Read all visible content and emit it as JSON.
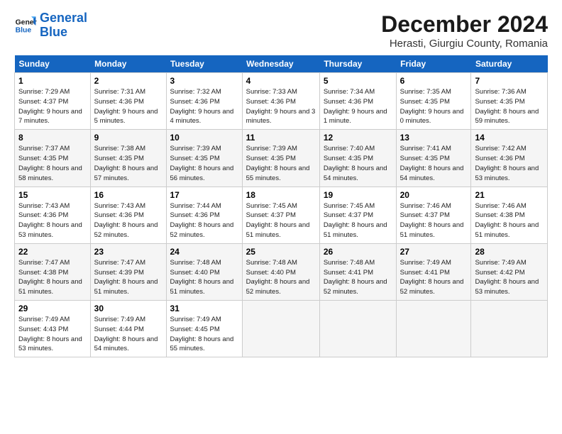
{
  "logo": {
    "line1": "General",
    "line2": "Blue"
  },
  "title": "December 2024",
  "subtitle": "Herasti, Giurgiu County, Romania",
  "days_of_week": [
    "Sunday",
    "Monday",
    "Tuesday",
    "Wednesday",
    "Thursday",
    "Friday",
    "Saturday"
  ],
  "weeks": [
    [
      {
        "num": "1",
        "sunrise": "Sunrise: 7:29 AM",
        "sunset": "Sunset: 4:37 PM",
        "daylight": "Daylight: 9 hours and 7 minutes."
      },
      {
        "num": "2",
        "sunrise": "Sunrise: 7:31 AM",
        "sunset": "Sunset: 4:36 PM",
        "daylight": "Daylight: 9 hours and 5 minutes."
      },
      {
        "num": "3",
        "sunrise": "Sunrise: 7:32 AM",
        "sunset": "Sunset: 4:36 PM",
        "daylight": "Daylight: 9 hours and 4 minutes."
      },
      {
        "num": "4",
        "sunrise": "Sunrise: 7:33 AM",
        "sunset": "Sunset: 4:36 PM",
        "daylight": "Daylight: 9 hours and 3 minutes."
      },
      {
        "num": "5",
        "sunrise": "Sunrise: 7:34 AM",
        "sunset": "Sunset: 4:36 PM",
        "daylight": "Daylight: 9 hours and 1 minute."
      },
      {
        "num": "6",
        "sunrise": "Sunrise: 7:35 AM",
        "sunset": "Sunset: 4:35 PM",
        "daylight": "Daylight: 9 hours and 0 minutes."
      },
      {
        "num": "7",
        "sunrise": "Sunrise: 7:36 AM",
        "sunset": "Sunset: 4:35 PM",
        "daylight": "Daylight: 8 hours and 59 minutes."
      }
    ],
    [
      {
        "num": "8",
        "sunrise": "Sunrise: 7:37 AM",
        "sunset": "Sunset: 4:35 PM",
        "daylight": "Daylight: 8 hours and 58 minutes."
      },
      {
        "num": "9",
        "sunrise": "Sunrise: 7:38 AM",
        "sunset": "Sunset: 4:35 PM",
        "daylight": "Daylight: 8 hours and 57 minutes."
      },
      {
        "num": "10",
        "sunrise": "Sunrise: 7:39 AM",
        "sunset": "Sunset: 4:35 PM",
        "daylight": "Daylight: 8 hours and 56 minutes."
      },
      {
        "num": "11",
        "sunrise": "Sunrise: 7:39 AM",
        "sunset": "Sunset: 4:35 PM",
        "daylight": "Daylight: 8 hours and 55 minutes."
      },
      {
        "num": "12",
        "sunrise": "Sunrise: 7:40 AM",
        "sunset": "Sunset: 4:35 PM",
        "daylight": "Daylight: 8 hours and 54 minutes."
      },
      {
        "num": "13",
        "sunrise": "Sunrise: 7:41 AM",
        "sunset": "Sunset: 4:35 PM",
        "daylight": "Daylight: 8 hours and 54 minutes."
      },
      {
        "num": "14",
        "sunrise": "Sunrise: 7:42 AM",
        "sunset": "Sunset: 4:36 PM",
        "daylight": "Daylight: 8 hours and 53 minutes."
      }
    ],
    [
      {
        "num": "15",
        "sunrise": "Sunrise: 7:43 AM",
        "sunset": "Sunset: 4:36 PM",
        "daylight": "Daylight: 8 hours and 53 minutes."
      },
      {
        "num": "16",
        "sunrise": "Sunrise: 7:43 AM",
        "sunset": "Sunset: 4:36 PM",
        "daylight": "Daylight: 8 hours and 52 minutes."
      },
      {
        "num": "17",
        "sunrise": "Sunrise: 7:44 AM",
        "sunset": "Sunset: 4:36 PM",
        "daylight": "Daylight: 8 hours and 52 minutes."
      },
      {
        "num": "18",
        "sunrise": "Sunrise: 7:45 AM",
        "sunset": "Sunset: 4:37 PM",
        "daylight": "Daylight: 8 hours and 51 minutes."
      },
      {
        "num": "19",
        "sunrise": "Sunrise: 7:45 AM",
        "sunset": "Sunset: 4:37 PM",
        "daylight": "Daylight: 8 hours and 51 minutes."
      },
      {
        "num": "20",
        "sunrise": "Sunrise: 7:46 AM",
        "sunset": "Sunset: 4:37 PM",
        "daylight": "Daylight: 8 hours and 51 minutes."
      },
      {
        "num": "21",
        "sunrise": "Sunrise: 7:46 AM",
        "sunset": "Sunset: 4:38 PM",
        "daylight": "Daylight: 8 hours and 51 minutes."
      }
    ],
    [
      {
        "num": "22",
        "sunrise": "Sunrise: 7:47 AM",
        "sunset": "Sunset: 4:38 PM",
        "daylight": "Daylight: 8 hours and 51 minutes."
      },
      {
        "num": "23",
        "sunrise": "Sunrise: 7:47 AM",
        "sunset": "Sunset: 4:39 PM",
        "daylight": "Daylight: 8 hours and 51 minutes."
      },
      {
        "num": "24",
        "sunrise": "Sunrise: 7:48 AM",
        "sunset": "Sunset: 4:40 PM",
        "daylight": "Daylight: 8 hours and 51 minutes."
      },
      {
        "num": "25",
        "sunrise": "Sunrise: 7:48 AM",
        "sunset": "Sunset: 4:40 PM",
        "daylight": "Daylight: 8 hours and 52 minutes."
      },
      {
        "num": "26",
        "sunrise": "Sunrise: 7:48 AM",
        "sunset": "Sunset: 4:41 PM",
        "daylight": "Daylight: 8 hours and 52 minutes."
      },
      {
        "num": "27",
        "sunrise": "Sunrise: 7:49 AM",
        "sunset": "Sunset: 4:41 PM",
        "daylight": "Daylight: 8 hours and 52 minutes."
      },
      {
        "num": "28",
        "sunrise": "Sunrise: 7:49 AM",
        "sunset": "Sunset: 4:42 PM",
        "daylight": "Daylight: 8 hours and 53 minutes."
      }
    ],
    [
      {
        "num": "29",
        "sunrise": "Sunrise: 7:49 AM",
        "sunset": "Sunset: 4:43 PM",
        "daylight": "Daylight: 8 hours and 53 minutes."
      },
      {
        "num": "30",
        "sunrise": "Sunrise: 7:49 AM",
        "sunset": "Sunset: 4:44 PM",
        "daylight": "Daylight: 8 hours and 54 minutes."
      },
      {
        "num": "31",
        "sunrise": "Sunrise: 7:49 AM",
        "sunset": "Sunset: 4:45 PM",
        "daylight": "Daylight: 8 hours and 55 minutes."
      },
      null,
      null,
      null,
      null
    ]
  ]
}
